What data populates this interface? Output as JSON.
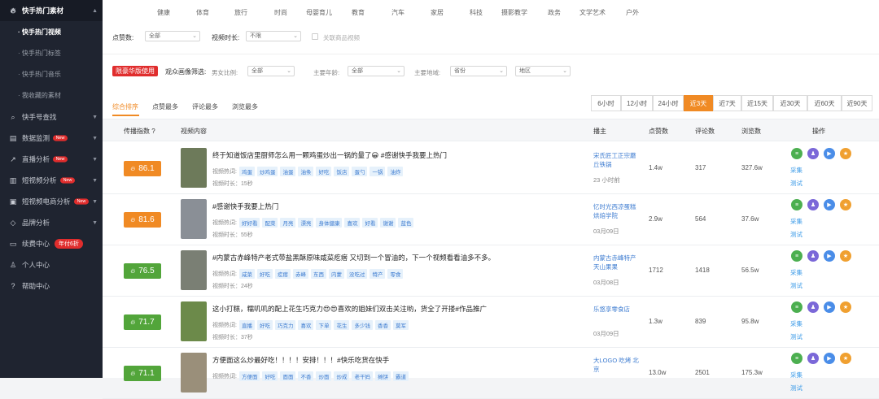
{
  "sidebar": {
    "header": "快手热门素材",
    "sub_items": [
      "· 快手热门视频",
      "· 快手热门标签",
      "· 快手热门音乐",
      "· 我收藏的素材"
    ],
    "items": [
      {
        "label": "快手号查找",
        "badge": ""
      },
      {
        "label": "数据监测",
        "badge": "New"
      },
      {
        "label": "直播分析",
        "badge": "New"
      },
      {
        "label": "短视频分析",
        "badge": "New"
      },
      {
        "label": "短视频电商分析",
        "badge": "New"
      },
      {
        "label": "品牌分析",
        "badge": ""
      },
      {
        "label": "续费中心",
        "badge": "年付6折"
      },
      {
        "label": "个人中心",
        "badge": ""
      },
      {
        "label": "帮助中心",
        "badge": ""
      }
    ]
  },
  "categories": [
    "健康",
    "体育",
    "旅行",
    "时尚",
    "母婴育儿",
    "教育",
    "汽车",
    "家居",
    "科技",
    "摄影教学",
    "政务",
    "文学艺术",
    "户外"
  ],
  "filters": {
    "likes_label": "点赞数:",
    "likes_value": "全部",
    "duration_label": "视频时长:",
    "duration_value": "不限",
    "related_goods": "关联商品视频",
    "limited_tag": "限豪华版使用",
    "audience_label": "观众画像筛选:",
    "gender_label": "男女比例:",
    "gender_value": "全部",
    "age_label": "主要年龄:",
    "age_value": "全部",
    "region_label": "主要地域:",
    "province_value": "省份",
    "area_value": "地区"
  },
  "sort_tabs": [
    "综合排序",
    "点赞最多",
    "评论最多",
    "浏览最多"
  ],
  "time_ranges": [
    "6小时",
    "12小时",
    "24小时",
    "近3天",
    "近7天",
    "近15天",
    "近30天",
    "近60天",
    "近90天"
  ],
  "active_time_range": "近3天",
  "table_headers": {
    "index": "传播指数 ?",
    "content": "视频内容",
    "host": "播主",
    "likes": "点赞数",
    "comments": "评论数",
    "views": "浏览数",
    "ops": "操作"
  },
  "labels": {
    "hot_words": "视频热词:",
    "collect": "采集",
    "test": "测试"
  },
  "rows": [
    {
      "score": "86.1",
      "color": "#f08a24",
      "title": "终于知道饭店里厨师怎么用一颗鸡蛋炒出一锅的量了😀 #感谢快手我要上热门",
      "tags": [
        "鸡蛋",
        "炒鸡蛋",
        "油蛋",
        "油条",
        "好吃",
        "饭店",
        "蛋勺",
        "一锅",
        "油炸"
      ],
      "duration": "视频时长：15秒",
      "host": "宋氏匠工正宗蘑 丘铁锅",
      "date": "23 小时前",
      "likes": "1.4w",
      "comments": "317",
      "views": "327.6w"
    },
    {
      "score": "81.6",
      "color": "#f08a24",
      "title": "#感谢快手我要上热门",
      "tags": [
        "好好看",
        "配菜",
        "月亮",
        "漂亮",
        "身体健康",
        "喜欢",
        "好看",
        "谢谢",
        "蓝色"
      ],
      "duration": "视频时长：55秒",
      "host": "忆时光西凉蛋糕 烘焙学院",
      "date": "03月09日",
      "likes": "2.9w",
      "comments": "564",
      "views": "37.6w"
    },
    {
      "score": "76.5",
      "color": "#52a53a",
      "title": "#内蒙古赤峰特产老式带盐黑酥原味咸菜疙瘩 又切到一个冒油的，下一个视频看看油多不多。",
      "tags": [
        "咸菜",
        "好吃",
        "疙瘩",
        "赤峰",
        "东西",
        "内蒙",
        "没吃过",
        "特产",
        "零食"
      ],
      "duration": "视频时长：24秒",
      "host": "内蒙古赤峰特产 天山果果",
      "date": "03月08日",
      "likes": "1712",
      "comments": "1418",
      "views": "56.5w"
    },
    {
      "score": "71.7",
      "color": "#52a53a",
      "title": "这小打糕，糯叽叽的配上花生巧克力😍😍喜欢的姐妹们双击关注哟，货全了开搂#作品推广",
      "tags": [
        "直播",
        "好吃",
        "巧克力",
        "喜欢",
        "下单",
        "花生",
        "多少钱",
        "香香",
        "莫军"
      ],
      "duration": "视频时长：37秒",
      "host": "乐悠享零食店",
      "date": "03月09日",
      "likes": "1.3w",
      "comments": "839",
      "views": "95.8w"
    },
    {
      "score": "71.1",
      "color": "#52a53a",
      "title": "方便面这么炒最好吃！！！！安排！！！#快乐吃货在快手",
      "tags": [
        "方便面",
        "好吃",
        "面面",
        "不香",
        "炒面",
        "炒成",
        "老干妈",
        "摊饼",
        "霸道"
      ],
      "duration": "",
      "host": "大LOGO 吃烤 北京",
      "date": "",
      "likes": "13.0w",
      "comments": "2501",
      "views": "175.3w"
    }
  ],
  "colors": {
    "accent": "#f08a24",
    "green": "#52a53a",
    "sidebar": "#1f2430",
    "link": "#3c7bd0"
  }
}
